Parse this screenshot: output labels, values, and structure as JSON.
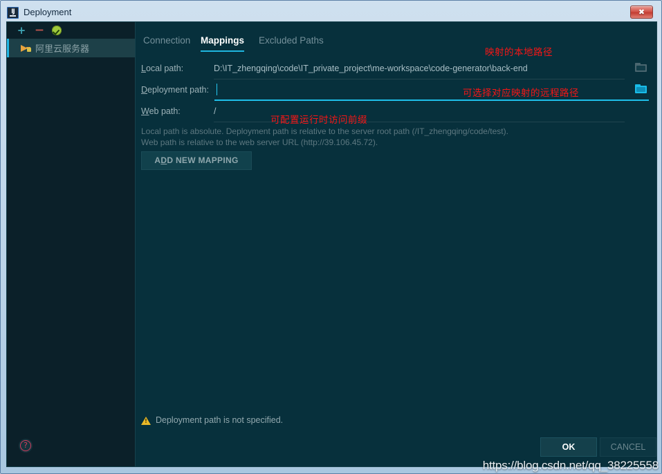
{
  "window": {
    "title": "Deployment",
    "app_icon": "intellij-idea-icon",
    "close_label": "✖"
  },
  "sidebar": {
    "toolbar": [
      {
        "name": "add-server-button",
        "glyph": "+",
        "color": "#3fa5b5"
      },
      {
        "name": "remove-server-button",
        "glyph": "−",
        "color": "#b5534d"
      },
      {
        "name": "test-connection-button",
        "glyph": "check-badge-icon",
        "color": "#9fc93c"
      }
    ],
    "servers": [
      {
        "label": "阿里云服务器",
        "selected": true
      }
    ]
  },
  "tabs": [
    {
      "label": "Connection",
      "active": false
    },
    {
      "label": "Mappings",
      "active": true
    },
    {
      "label": "Excluded Paths",
      "active": false
    }
  ],
  "form": {
    "local_path": {
      "label_prefix": "L",
      "label_rest": "ocal path:",
      "value": "D:\\IT_zhengqing\\code\\IT_private_project\\me-workspace\\code-generator\\back-end",
      "browse_icon": "folder-icon"
    },
    "deployment_path": {
      "label_prefix": "D",
      "label_rest": "eployment path:",
      "value": "",
      "browse_icon": "folder-icon"
    },
    "web_path": {
      "label_prefix": "W",
      "label_rest": "eb path:",
      "value": "/"
    }
  },
  "hints": {
    "line1": "Local path is absolute. Deployment path is relative to the server root path (/IT_zhengqing/code/test).",
    "line2": "Web path is relative to the web server URL (http://39.106.45.72)."
  },
  "add_mapping_button": {
    "prefix": "A",
    "mnemonic": "D",
    "rest": "D NEW MAPPING"
  },
  "warning": {
    "icon": "warning-triangle-icon",
    "text": "Deployment path is not specified."
  },
  "footer": {
    "help_label": "?",
    "ok_label": "OK",
    "cancel_label": "CANCEL"
  },
  "annotations": {
    "local": "映射的本地路径",
    "deployment": "可选择对应映射的远程路径",
    "web": "可配置运行时访问前缀"
  },
  "watermark": "https://blog.csdn.net/qq_38225558",
  "colors": {
    "accent": "#1fb6e0",
    "panel_bg": "#07303c",
    "sidebar_bg": "#0b2029",
    "selection_bg": "#1d4048",
    "annotation_red": "#f71616",
    "warning_yellow": "#e8b828"
  }
}
